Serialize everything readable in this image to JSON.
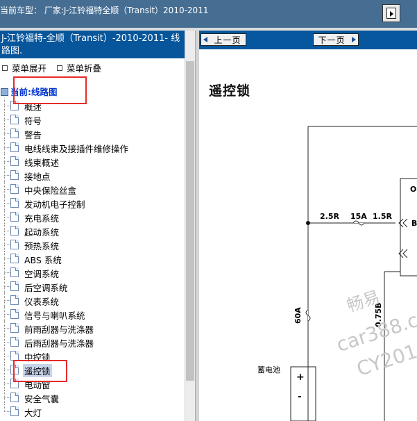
{
  "header": {
    "vehicle_title": "当前车型： 厂家:J-江铃福特全顺（Transit）2010-2011",
    "expand_icon": "panel-toggle-icon"
  },
  "sidebar": {
    "title": "J-江铃福特-全顺（Transit）-2010-2011- 线路图.",
    "menu_expand": "菜单展开",
    "menu_collapse": "菜单折叠",
    "current_label": "当前:线路图",
    "items": [
      {
        "label": "概述"
      },
      {
        "label": "符号"
      },
      {
        "label": "警告"
      },
      {
        "label": "电线线束及接插件维修操作"
      },
      {
        "label": "线束概述"
      },
      {
        "label": "接地点"
      },
      {
        "label": "中央保险丝盒"
      },
      {
        "label": "发动机电子控制"
      },
      {
        "label": "充电系统"
      },
      {
        "label": "起动系统"
      },
      {
        "label": "预热系统"
      },
      {
        "label": "ABS 系统"
      },
      {
        "label": "空调系统"
      },
      {
        "label": "后空调系统"
      },
      {
        "label": "仪表系统"
      },
      {
        "label": "信号与喇叭系统"
      },
      {
        "label": "前雨刮器与洗涤器"
      },
      {
        "label": "后雨刮器与洗涤器"
      },
      {
        "label": "中控锁"
      },
      {
        "label": "遥控锁",
        "selected": true
      },
      {
        "label": "电动窗"
      },
      {
        "label": "安全气囊"
      },
      {
        "label": "大灯"
      }
    ],
    "highlight_color": "#e52b2b"
  },
  "content": {
    "prev_button": "上一页",
    "next_button": "下一页",
    "page_title": "遥控锁",
    "diagram": {
      "wire1_label": "2.5R",
      "fuse1_label": "15A",
      "wire2_label": "1.5R",
      "fuse2_label": "60A",
      "wire3_label": "0.75B",
      "battery_label": "蓄电池",
      "plus_sign": "+",
      "minus_sign": "-",
      "box_letter_o": "O",
      "box_letter_b": "B"
    },
    "watermark": {
      "line1": "畅易",
      "line2": "car388.c",
      "line3": "CY201"
    }
  },
  "colors": {
    "topbar": "#466e93",
    "panel_header": "#07569c",
    "link": "#0033cc"
  }
}
